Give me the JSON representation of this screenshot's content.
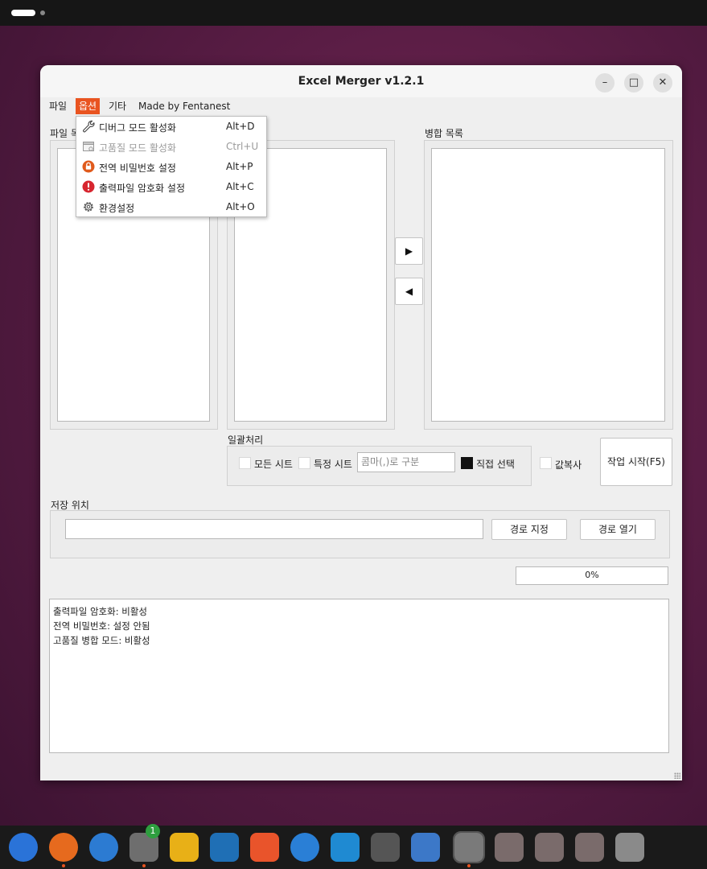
{
  "window": {
    "title": "Excel Merger v1.2.1",
    "minimize_symbol": "–",
    "maximize_symbol": "□",
    "close_symbol": "✕"
  },
  "menubar": {
    "items": [
      "파일",
      "옵션",
      "기타",
      "Made by Fentanest"
    ],
    "active_item": "옵션"
  },
  "options_menu": {
    "items": [
      {
        "label": "디버그 모드 활성화",
        "shortcut": "Alt+D",
        "icon": "wrench-icon",
        "enabled": true
      },
      {
        "label": "고품질 모드 활성화",
        "shortcut": "Ctrl+U",
        "icon": "window-settings-icon",
        "enabled": false
      },
      {
        "label": "전역 비밀번호 설정",
        "shortcut": "Alt+P",
        "icon": "lock-icon",
        "enabled": true
      },
      {
        "label": "출력파일 암호화 설정",
        "shortcut": "Alt+C",
        "icon": "alert-icon",
        "enabled": true
      },
      {
        "label": "환경설정",
        "shortcut": "Alt+O",
        "icon": "gear-icon",
        "enabled": true
      }
    ]
  },
  "panels": {
    "file_list_label": "파일 목록",
    "merge_list_label": "병합 목록"
  },
  "move_buttons": {
    "right": "▶",
    "left": "◀"
  },
  "batch": {
    "label": "일괄처리",
    "all_sheets_label": "모든 시트",
    "specific_sheets_label": "특정 시트",
    "sheet_input_placeholder": "콤마(,)로 구분",
    "direct_select_label": "직접 선택",
    "direct_select_checked": true,
    "value_copy_label": "값복사",
    "start_button_label": "작업 시작(F5)"
  },
  "save": {
    "label": "저장 위치",
    "path_value": "",
    "set_path_label": "경로 지정",
    "open_path_label": "경로 열기"
  },
  "progress": {
    "text": "0%",
    "value": 0
  },
  "log": {
    "lines": [
      "출력파일 암호화: 비활성",
      "전역 비밀번호: 설정 안됨",
      "고품질 병합 모드: 비활성"
    ]
  },
  "dock": {
    "badge_count": "1",
    "apps": [
      {
        "name": "chromium-icon",
        "color": "#2a73d8"
      },
      {
        "name": "firefox-icon",
        "color": "#e66a1e"
      },
      {
        "name": "thunderbird-icon",
        "color": "#2c7bd2"
      },
      {
        "name": "files-icon",
        "color": "#6e6e6e"
      },
      {
        "name": "rhythmbox-icon",
        "color": "#e8b017"
      },
      {
        "name": "writer-icon",
        "color": "#1f6fb5"
      },
      {
        "name": "app-center-icon",
        "color": "#e9542b"
      },
      {
        "name": "help-icon",
        "color": "#2a7fd6"
      },
      {
        "name": "vscode-icon",
        "color": "#1f8ad2"
      },
      {
        "name": "vmware-icon",
        "color": "#555555"
      },
      {
        "name": "text-editor-icon",
        "color": "#3c78c8"
      },
      {
        "name": "settings-icon",
        "color": "#7a7a7a"
      },
      {
        "name": "folder-icon",
        "color": "#7a6b6b"
      },
      {
        "name": "folder-icon",
        "color": "#7a6b6b"
      },
      {
        "name": "folder-icon",
        "color": "#7a6b6b"
      },
      {
        "name": "trash-icon",
        "color": "#8a8a8a"
      }
    ]
  }
}
